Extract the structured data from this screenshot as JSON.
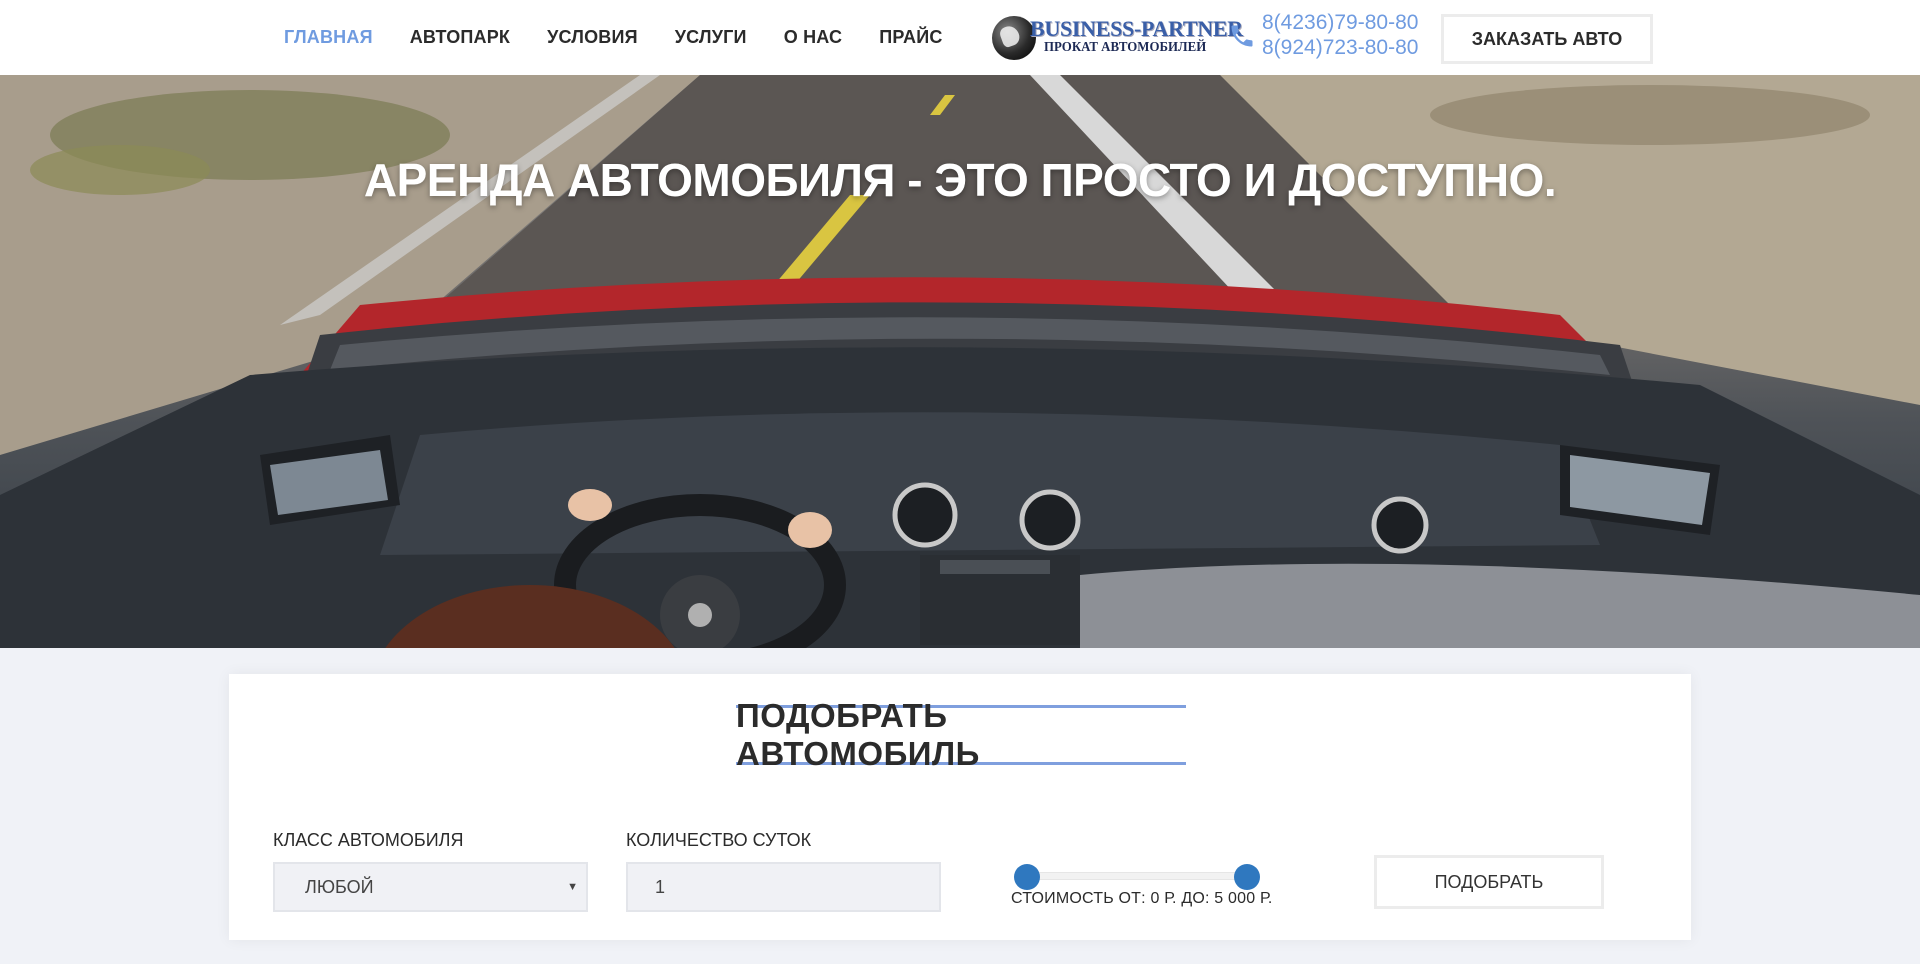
{
  "nav": {
    "items": [
      {
        "label": "ГЛАВНАЯ",
        "active": true
      },
      {
        "label": "АВТОПАРК",
        "active": false
      },
      {
        "label": "УСЛОВИЯ",
        "active": false
      },
      {
        "label": "УСЛУГИ",
        "active": false
      },
      {
        "label": "О НАС",
        "active": false
      },
      {
        "label": "ПРАЙС",
        "active": false
      }
    ]
  },
  "logo": {
    "line1": "BUSINESS-PARTNER",
    "line2": "ПРОКАТ АВТОМОБИЛЕЙ"
  },
  "contacts": {
    "phone1": "8(4236)79-80-80",
    "phone2": "8(924)723-80-80",
    "icon": "phone-icon"
  },
  "header": {
    "order_button": "ЗАКАЗАТЬ АВТО"
  },
  "hero": {
    "title": "АРЕНДА АВТОМОБИЛЯ - ЭТО ПРОСТО И ДОСТУПНО."
  },
  "filter": {
    "title": "ПОДОБРАТЬ АВТОМОБИЛЬ",
    "class_label": "КЛАСС АВТОМОБИЛЯ",
    "class_value": "ЛЮБОЙ",
    "days_label": "КОЛИЧЕСТВО СУТОК",
    "days_value": "1",
    "price_text": "СТОИМОСТЬ ОТ: 0 Р. ДО: 5 000 Р.",
    "price_min": 0,
    "price_max": 5000,
    "submit_button": "ПОДОБРАТЬ"
  },
  "colors": {
    "accent": "#6f9be0",
    "slider_thumb": "#2f78bf",
    "text": "#2b2b2b",
    "page_bg": "#f0f2f7"
  }
}
